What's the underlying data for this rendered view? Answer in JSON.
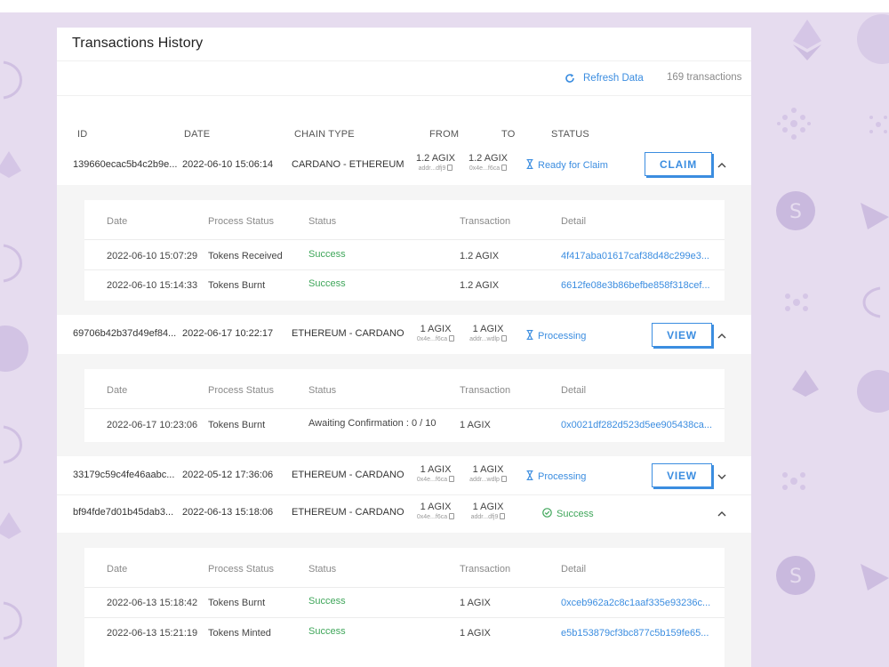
{
  "panel": {
    "title": "Transactions History",
    "refresh_label": "Refresh Data",
    "tx_count": "169 transactions"
  },
  "columns": {
    "id": "ID",
    "date": "DATE",
    "chain_type": "CHAIN TYPE",
    "from": "FROM",
    "to": "TO",
    "status": "STATUS"
  },
  "detail_columns": {
    "date": "Date",
    "process_status": "Process Status",
    "status": "Status",
    "transaction": "Transaction",
    "detail": "Detail"
  },
  "transactions": [
    {
      "id": "139660ecac5b4c2b9e...",
      "date": "2022-06-10 15:06:14",
      "chain": "CARDANO - ETHEREUM",
      "from_amount": "1.2 AGIX",
      "from_addr": "addr...dfj9",
      "to_amount": "1.2 AGIX",
      "to_addr": "0x4e...f6ca",
      "status": "Ready for Claim",
      "action": "CLAIM",
      "details": [
        {
          "date": "2022-06-10 15:07:29",
          "process": "Tokens Received",
          "status": "Success",
          "transaction": "1.2 AGIX",
          "detail": "4f417aba01617caf38d48c299e3..."
        },
        {
          "date": "2022-06-10 15:14:33",
          "process": "Tokens Burnt",
          "status": "Success",
          "transaction": "1.2 AGIX",
          "detail": "6612fe08e3b86befbe858f318cef..."
        }
      ]
    },
    {
      "id": "69706b42b37d49ef84...",
      "date": "2022-06-17 10:22:17",
      "chain": "ETHEREUM - CARDANO",
      "from_amount": "1 AGIX",
      "from_addr": "0x4e...f6ca",
      "to_amount": "1 AGIX",
      "to_addr": "addr...wdlp",
      "status": "Processing",
      "action": "VIEW",
      "details": [
        {
          "date": "2022-06-17 10:23:06",
          "process": "Tokens Burnt",
          "status": "Awaiting Confirmation : 0 / 10",
          "transaction": "1 AGIX",
          "detail": "0x0021df282d523d5ee905438ca..."
        }
      ]
    },
    {
      "id": "33179c59c4fe46aabc...",
      "date": "2022-05-12 17:36:06",
      "chain": "ETHEREUM - CARDANO",
      "from_amount": "1 AGIX",
      "from_addr": "0x4e...f6ca",
      "to_amount": "1 AGIX",
      "to_addr": "addr...wdlp",
      "status": "Processing",
      "action": "VIEW"
    },
    {
      "id": "bf94fde7d01b45dab3...",
      "date": "2022-06-13 15:18:06",
      "chain": "ETHEREUM - CARDANO",
      "from_amount": "1 AGIX",
      "from_addr": "0x4e...f6ca",
      "to_amount": "1 AGIX",
      "to_addr": "addr...dfj9",
      "status": "Success",
      "details": [
        {
          "date": "2022-06-13 15:18:42",
          "process": "Tokens Burnt",
          "status": "Success",
          "transaction": "1 AGIX",
          "detail": "0xceb962a2c8c1aaf335e93236c..."
        },
        {
          "date": "2022-06-13 15:21:19",
          "process": "Tokens Minted",
          "status": "Success",
          "transaction": "1 AGIX",
          "detail": "e5b153879cf3bc877c5b159fe65..."
        }
      ]
    }
  ],
  "icons": {
    "refresh": "refresh-icon",
    "hourglass": "hourglass-icon",
    "check": "check-circle-icon",
    "chevron_up": "chevron-up-icon",
    "chevron_down": "chevron-down-icon",
    "copy": "copy-icon"
  },
  "colors": {
    "accent": "#3b8de0",
    "success": "#3fa65a",
    "background": "#e6dcef"
  }
}
